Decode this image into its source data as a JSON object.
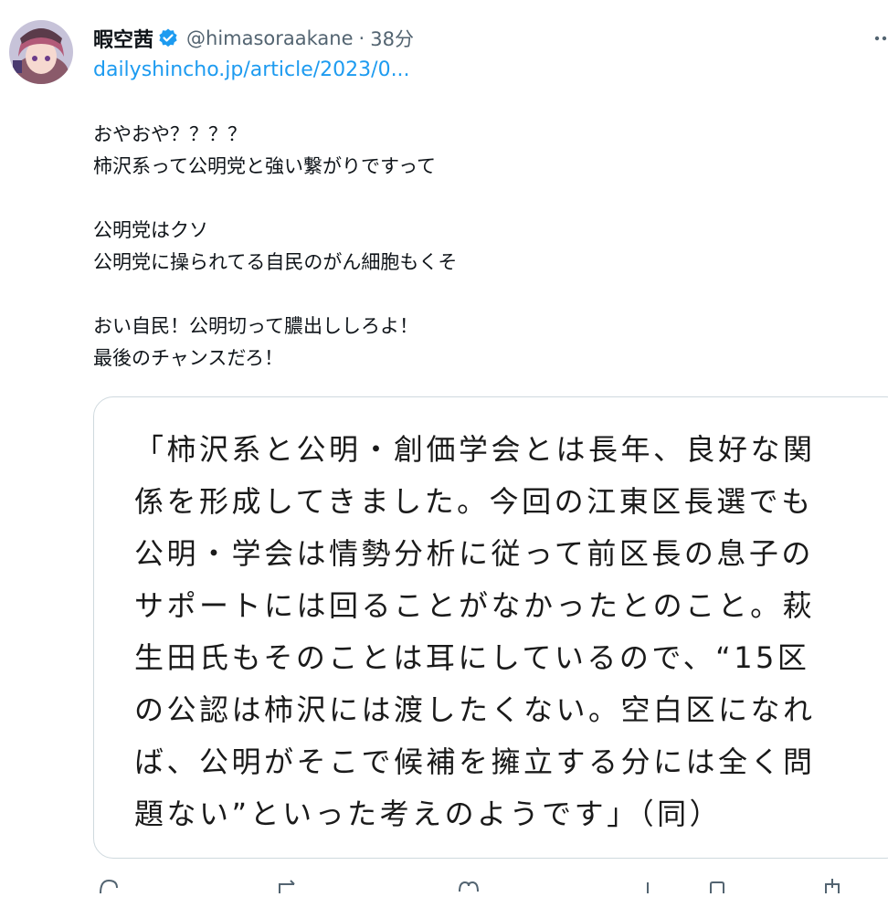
{
  "tweet": {
    "display_name": "暇空茜",
    "handle": "@himasoraakane",
    "separator": "·",
    "time": "38分",
    "link": "dailyshincho.jp/article/2023/0...",
    "lines": [
      "おやおや？？？？",
      "柿沢系って公明党と強い繋がりですって",
      "",
      "公明党はクソ",
      "公明党に操られてる自民のがん細胞もくそ",
      "",
      "おい自民！公明切って膿出ししろよ！",
      "最後のチャンスだろ！"
    ]
  },
  "quote": {
    "lines": [
      "「柿沢系と公明・創価学会とは長年、良好な関",
      "係を形成してきました。今回の江東区長選でも",
      "公明・学会は情勢分析に従って前区長の息子の",
      "サポートには回ることがなかったとのこと。萩",
      "生田氏もそのことは耳にしているので、“15区",
      "の公認は柿沢には渡したくない。空白区になれ",
      "ば、公明がそこで候補を擁立する分には全く問",
      "題ない”といった考えのようです」（同）"
    ]
  },
  "icons": {
    "avatar": "avatar-image",
    "verified": "verified-badge-icon",
    "more": "more-options-icon",
    "reply": "reply-icon",
    "retweet": "retweet-icon",
    "like": "like-icon",
    "views": "views-icon",
    "bookmark": "bookmark-icon",
    "share": "share-icon"
  },
  "colors": {
    "link": "#1d9bf0",
    "verified": "#1d9bf0",
    "secondary_text": "#536471",
    "border": "#cfd9de"
  }
}
